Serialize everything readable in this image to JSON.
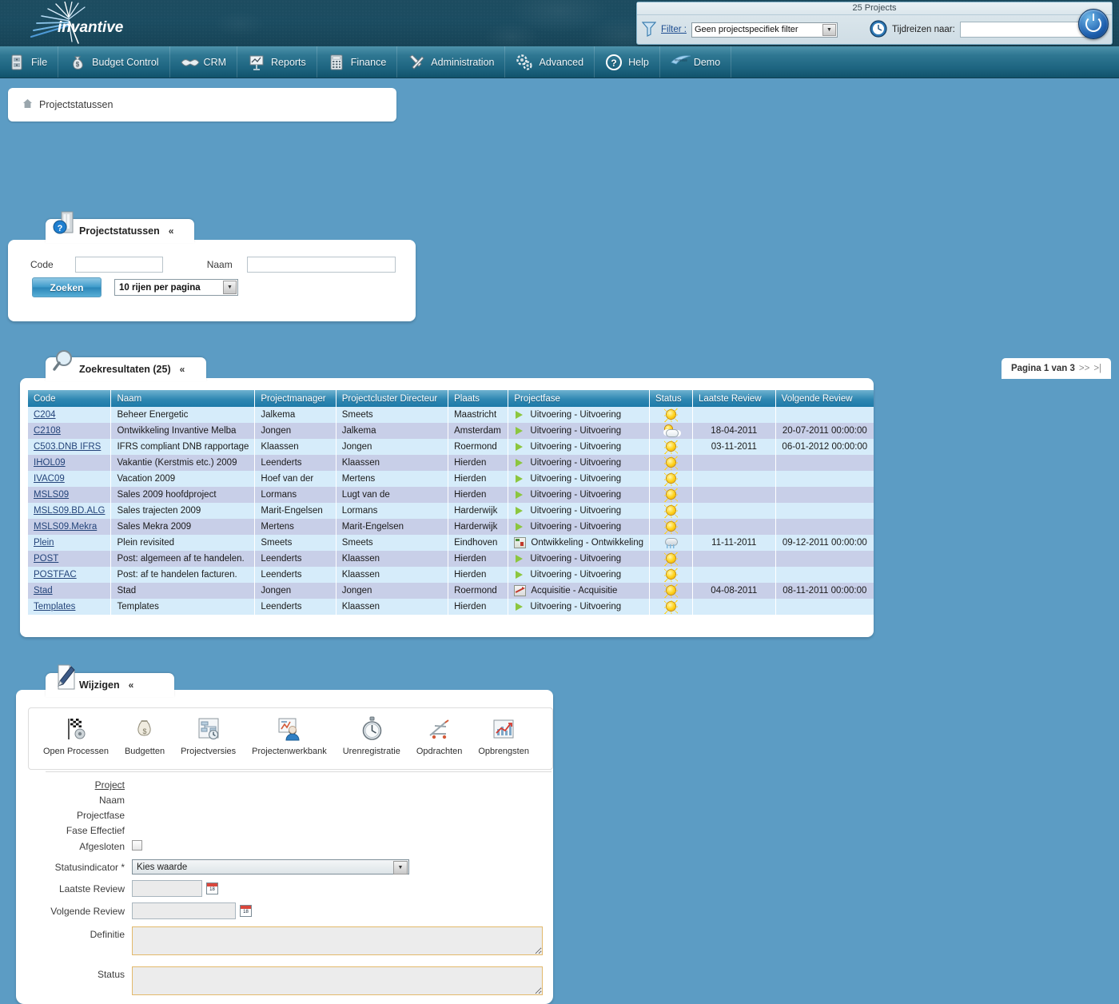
{
  "brand": {
    "name": "invantive"
  },
  "toolbox": {
    "title": "25 Projects",
    "filter_label": "Filter :",
    "filter_value": "Geen projectspecifiek filter",
    "timetravel_label": "Tijdreizen naar:",
    "timetravel_value": "",
    "filter_icon": "funnel-icon",
    "timetravel_icon": "clock-icon",
    "power_icon": "power-icon"
  },
  "menu": [
    {
      "label": "File",
      "icon": "file-cabinet-icon"
    },
    {
      "label": "Budget Control",
      "icon": "money-bag-icon"
    },
    {
      "label": "CRM",
      "icon": "handshake-icon"
    },
    {
      "label": "Reports",
      "icon": "presentation-chart-icon"
    },
    {
      "label": "Finance",
      "icon": "calculator-icon"
    },
    {
      "label": "Administration",
      "icon": "tools-icon"
    },
    {
      "label": "Advanced",
      "icon": "gears-icon"
    },
    {
      "label": "Help",
      "icon": "question-mark-icon"
    },
    {
      "label": "Demo",
      "icon": "invantive-swoosh-icon"
    }
  ],
  "breadcrumb": {
    "home_icon": "home-icon",
    "label": "Projectstatussen"
  },
  "search": {
    "tab_label": "Projectstatussen",
    "tab_icon": "building-icon",
    "help_icon": "help-bubble-icon",
    "collapse_icon": "chevron-up-icon",
    "code_label": "Code",
    "code_value": "",
    "naam_label": "Naam",
    "naam_value": "",
    "button_label": "Zoeken",
    "rows_per_page": "10 rijen per pagina"
  },
  "results": {
    "tab_label": "Zoekresultaten (25)",
    "tab_icon": "magnifier-icon",
    "collapse_icon": "chevron-up-icon",
    "pager_text": "Pagina 1 van 3",
    "pager_next": ">>",
    "pager_last": ">|",
    "columns": [
      "Code",
      "Naam",
      "Projectmanager",
      "Projectcluster Directeur",
      "Plaats",
      "Projectfase",
      "Status",
      "Laatste Review",
      "Volgende Review"
    ],
    "rows": [
      {
        "code": "C204",
        "naam": "Beheer Energetic",
        "manager": "Jalkema",
        "directeur": "Smeets",
        "plaats": "Maastricht",
        "fase": "Uitvoering - Uitvoering",
        "fase_icon": "play-green-icon",
        "status_icon": "sun-icon",
        "laatste": "",
        "volgende": ""
      },
      {
        "code": "C2108",
        "naam": "Ontwikkeling Invantive Melba",
        "manager": "Jongen",
        "directeur": "Jalkema",
        "plaats": "Amsterdam",
        "fase": "Uitvoering - Uitvoering",
        "fase_icon": "play-green-icon",
        "status_icon": "sun-behind-cloud-icon",
        "laatste": "18-04-2011",
        "volgende": "20-07-2011 00:00:00"
      },
      {
        "code": "C503.DNB IFRS",
        "naam": "IFRS compliant DNB rapportage",
        "manager": "Klaassen",
        "directeur": "Jongen",
        "plaats": "Roermond",
        "fase": "Uitvoering - Uitvoering",
        "fase_icon": "play-green-icon",
        "status_icon": "sun-icon",
        "laatste": "03-11-2011",
        "volgende": "06-01-2012 00:00:00"
      },
      {
        "code": "IHOL09",
        "naam": "Vakantie (Kerstmis etc.) 2009",
        "manager": "Leenderts",
        "directeur": "Klaassen",
        "plaats": "Hierden",
        "fase": "Uitvoering - Uitvoering",
        "fase_icon": "play-green-icon",
        "status_icon": "sun-icon",
        "laatste": "",
        "volgende": ""
      },
      {
        "code": "IVAC09",
        "naam": "Vacation 2009",
        "manager": "Hoef van der",
        "directeur": "Mertens",
        "plaats": "Hierden",
        "fase": "Uitvoering - Uitvoering",
        "fase_icon": "play-green-icon",
        "status_icon": "sun-icon",
        "laatste": "",
        "volgende": ""
      },
      {
        "code": "MSLS09",
        "naam": "Sales 2009 hoofdproject",
        "manager": "Lormans",
        "directeur": "Lugt van de",
        "plaats": "Hierden",
        "fase": "Uitvoering - Uitvoering",
        "fase_icon": "play-green-icon",
        "status_icon": "sun-icon",
        "laatste": "",
        "volgende": ""
      },
      {
        "code": "MSLS09.BD.ALG",
        "naam": "Sales trajecten 2009",
        "manager": "Marit-Engelsen",
        "directeur": "Lormans",
        "plaats": "Harderwijk",
        "fase": "Uitvoering - Uitvoering",
        "fase_icon": "play-green-icon",
        "status_icon": "sun-icon",
        "laatste": "",
        "volgende": ""
      },
      {
        "code": "MSLS09.Mekra",
        "naam": "Sales Mekra 2009",
        "manager": "Mertens",
        "directeur": "Marit-Engelsen",
        "plaats": "Harderwijk",
        "fase": "Uitvoering - Uitvoering",
        "fase_icon": "play-green-icon",
        "status_icon": "sun-icon",
        "laatste": "",
        "volgende": ""
      },
      {
        "code": "Plein",
        "naam": "Plein revisited",
        "manager": "Smeets",
        "directeur": "Smeets",
        "plaats": "Eindhoven",
        "fase": "Ontwikkeling - Ontwikkeling",
        "fase_icon": "development-chart-icon",
        "status_icon": "rain-cloud-icon",
        "laatste": "11-11-2011",
        "volgende": "09-12-2011 00:00:00"
      },
      {
        "code": "POST",
        "naam": "Post: algemeen af te handelen.",
        "manager": "Leenderts",
        "directeur": "Klaassen",
        "plaats": "Hierden",
        "fase": "Uitvoering - Uitvoering",
        "fase_icon": "play-green-icon",
        "status_icon": "sun-icon",
        "laatste": "",
        "volgende": ""
      },
      {
        "code": "POSTFAC",
        "naam": "Post: af te handelen facturen.",
        "manager": "Leenderts",
        "directeur": "Klaassen",
        "plaats": "Hierden",
        "fase": "Uitvoering - Uitvoering",
        "fase_icon": "play-green-icon",
        "status_icon": "sun-icon",
        "laatste": "",
        "volgende": ""
      },
      {
        "code": "Stad",
        "naam": "Stad",
        "manager": "Jongen",
        "directeur": "Jongen",
        "plaats": "Roermond",
        "fase": "Acquisitie - Acquisitie",
        "fase_icon": "acquisition-chart-icon",
        "status_icon": "sun-icon",
        "laatste": "04-08-2011",
        "volgende": "08-11-2011 00:00:00"
      },
      {
        "code": "Templates",
        "naam": "Templates",
        "manager": "Leenderts",
        "directeur": "Klaassen",
        "plaats": "Hierden",
        "fase": "Uitvoering - Uitvoering",
        "fase_icon": "play-green-icon",
        "status_icon": "sun-icon",
        "laatste": "",
        "volgende": ""
      }
    ]
  },
  "edit": {
    "tab_label": "Wijzigen",
    "tab_icon": "pencil-document-icon",
    "collapse_icon": "chevron-up-icon",
    "shortcuts": [
      {
        "label": "Open Processen",
        "icon": "checkered-flag-icon"
      },
      {
        "label": "Budgetten",
        "icon": "money-bags-icon"
      },
      {
        "label": "Projectversies",
        "icon": "flowchart-clock-icon"
      },
      {
        "label": "Projectenwerkbank",
        "icon": "workbench-user-icon"
      },
      {
        "label": "Urenregistratie",
        "icon": "stopwatch-icon"
      },
      {
        "label": "Opdrachten",
        "icon": "shopping-cart-icon"
      },
      {
        "label": "Opbrengsten",
        "icon": "revenue-chart-icon"
      }
    ],
    "fields": {
      "project_label": "Project",
      "project_value": "",
      "naam_label": "Naam",
      "naam_value": "",
      "projectfase_label": "Projectfase",
      "projectfase_value": "",
      "fase_effectief_label": "Fase Effectief",
      "fase_effectief_value": "",
      "afgesloten_label": "Afgesloten",
      "statusindicator_label": "Statusindicator *",
      "statusindicator_value": "Kies waarde",
      "laatste_review_label": "Laatste Review",
      "laatste_review_value": "",
      "volgende_review_label": "Volgende Review",
      "volgende_review_value": "",
      "definitie_label": "Definitie",
      "definitie_value": "",
      "status_label": "Status",
      "status_value": ""
    }
  }
}
